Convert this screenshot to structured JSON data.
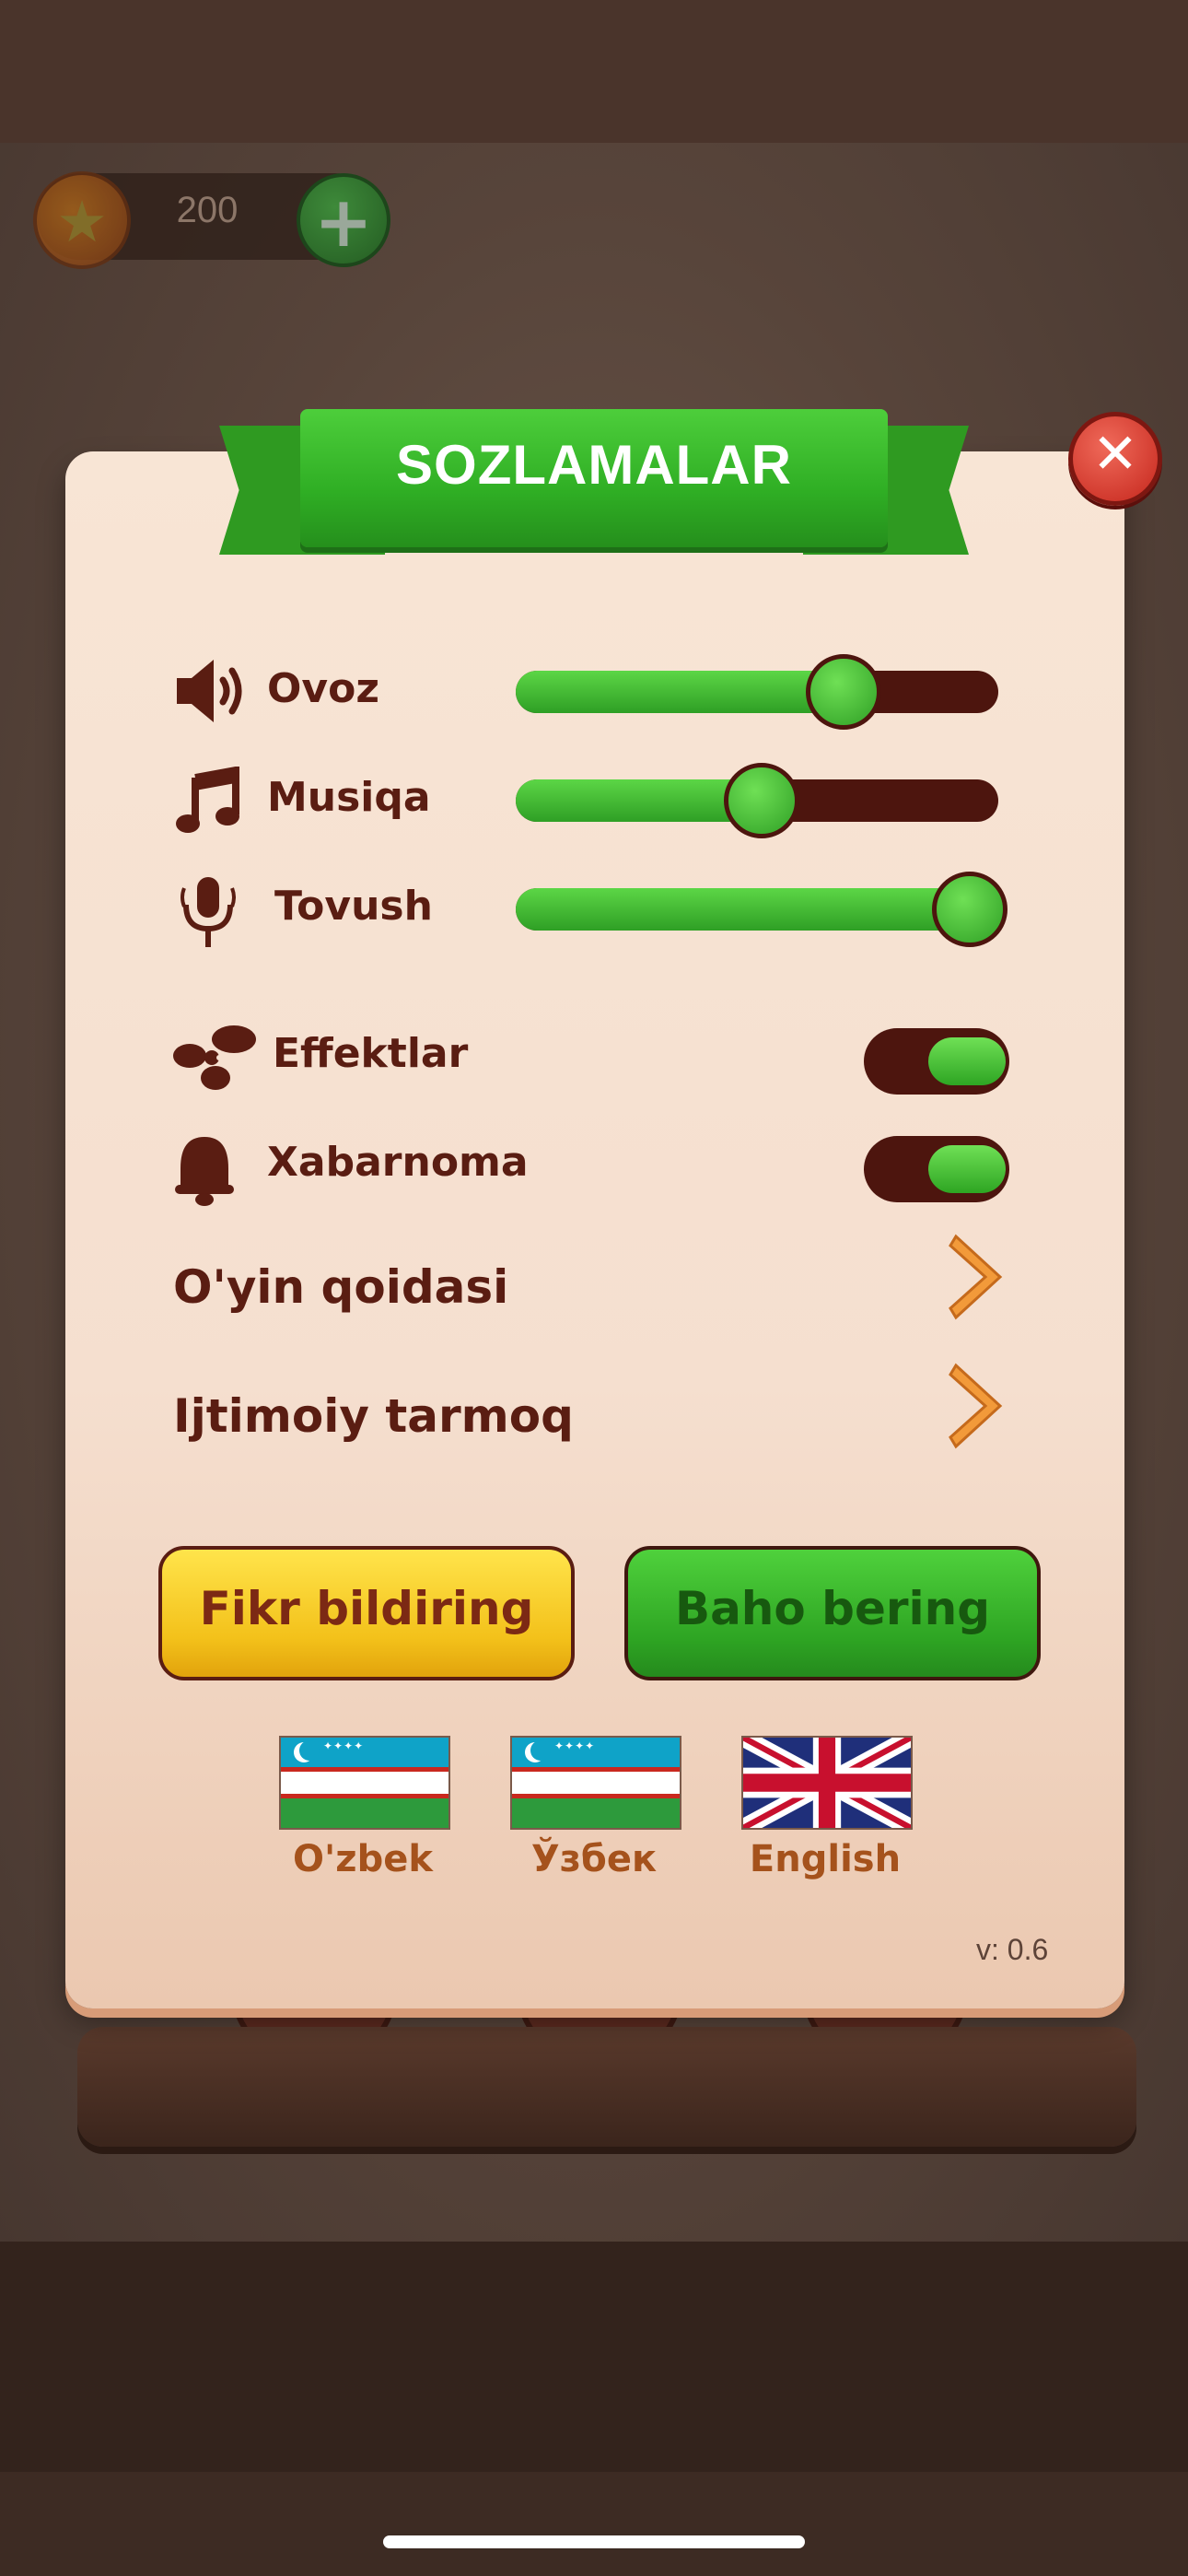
{
  "hud": {
    "coins": "200"
  },
  "dialog": {
    "title": "SOZLAMALAR",
    "sliders": [
      {
        "label": "Ovoz",
        "icon": "speaker-icon",
        "value_percent": 68
      },
      {
        "label": "Musiqa",
        "icon": "music-note-icon",
        "value_percent": 51
      },
      {
        "label": "Tovush",
        "icon": "microphone-icon",
        "value_percent": 94
      }
    ],
    "toggles": [
      {
        "label": "Effektlar",
        "icon": "effects-icon",
        "on": true
      },
      {
        "label": "Xabarnoma",
        "icon": "bell-icon",
        "on": true
      }
    ],
    "links": [
      {
        "label": "O'yin qoidasi"
      },
      {
        "label": "Ijtimoiy tarmoq"
      }
    ],
    "buttons": {
      "feedback": "Fikr bildiring",
      "rate": "Baho bering"
    },
    "languages": [
      {
        "label": "O'zbek",
        "flag": "uzbekistan-flag"
      },
      {
        "label": "Ўзбек",
        "flag": "uzbekistan-flag"
      },
      {
        "label": "English",
        "flag": "uk-flag"
      }
    ],
    "version": "v: 0.6"
  },
  "colors": {
    "panel": "#f6e1d1",
    "accent_green": "#2fae24",
    "dark_brown": "#5a1d12",
    "button_yellow": "#f3c11a",
    "chevron_orange": "#f29a3a"
  }
}
